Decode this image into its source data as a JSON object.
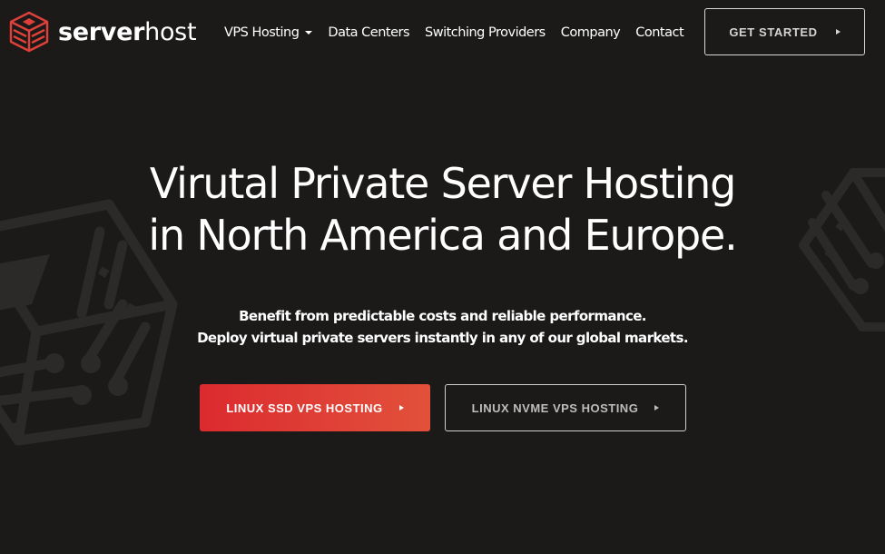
{
  "brand": {
    "name_bold": "server",
    "name_light": "host",
    "logo_icon": "server-cube-icon",
    "accent_color": "#e0403a"
  },
  "nav": {
    "items": [
      {
        "label": "VPS Hosting",
        "has_dropdown": true
      },
      {
        "label": "Data Centers",
        "has_dropdown": false
      },
      {
        "label": "Switching Providers",
        "has_dropdown": false
      },
      {
        "label": "Company",
        "has_dropdown": false
      },
      {
        "label": "Contact",
        "has_dropdown": false
      }
    ],
    "cta_label": "GET STARTED",
    "cta_icon": "play-triangle-icon"
  },
  "hero": {
    "title_lines": [
      "Virutal Private Server Hosting",
      "in North America and Europe."
    ],
    "subtitle_lines": [
      "Benefit from predictable costs and reliable performance.",
      "Deploy virtual private servers instantly in any of our global markets."
    ],
    "primary_button": {
      "label": "LINUX SSD VPS HOSTING",
      "icon": "play-triangle-icon"
    },
    "secondary_button": {
      "label": "LINUX NVME VPS HOSTING",
      "icon": "play-triangle-icon"
    }
  },
  "colors": {
    "background": "#1b1a19",
    "primary_gradient_start": "#dc2a30",
    "primary_gradient_end": "#e2513a",
    "decor_cube": "#2c2b2a"
  }
}
